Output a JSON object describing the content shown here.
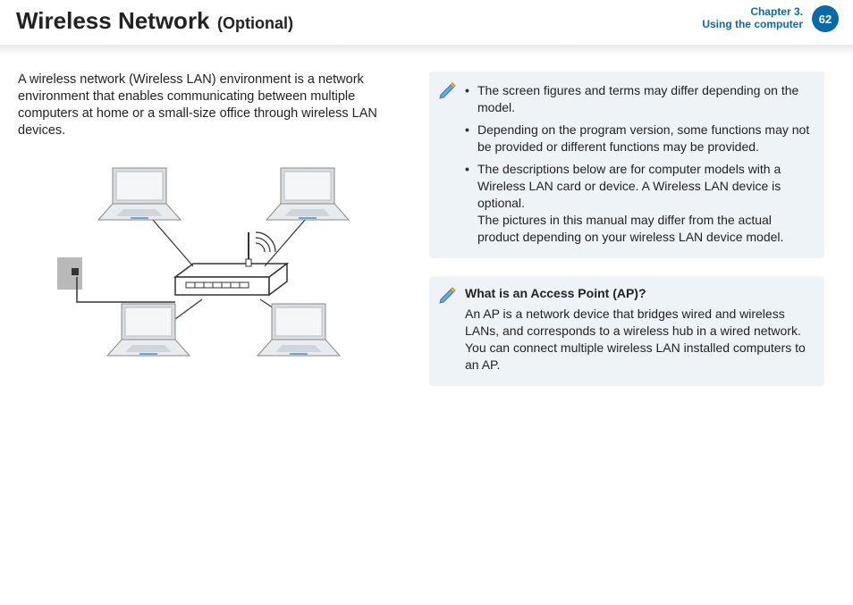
{
  "header": {
    "title": "Wireless Network",
    "subtitle": "(Optional)",
    "chapter_line1": "Chapter 3.",
    "chapter_line2": "Using the computer",
    "page_number": "62"
  },
  "intro": "A wireless network (Wireless LAN) environment is a network environment that enables communicating between multiple computers at home or a small-size office through wireless LAN devices.",
  "note1": {
    "items": [
      {
        "text": "The screen figures and terms may differ depending on the model."
      },
      {
        "text": "Depending on the program version, some functions may not be provided or different functions may be provided."
      },
      {
        "text": "The descriptions below are for computer models with a Wireless LAN card or device. A Wireless LAN device is optional.",
        "sub": "The pictures in this manual may differ from the actual product depending on your wireless LAN device model."
      }
    ]
  },
  "note2": {
    "title": "What is an Access Point (AP)?",
    "body": "An AP is a network device that bridges wired and wireless LANs, and corresponds to a wireless hub in a wired network. You can connect multiple wireless LAN installed computers to an AP."
  }
}
